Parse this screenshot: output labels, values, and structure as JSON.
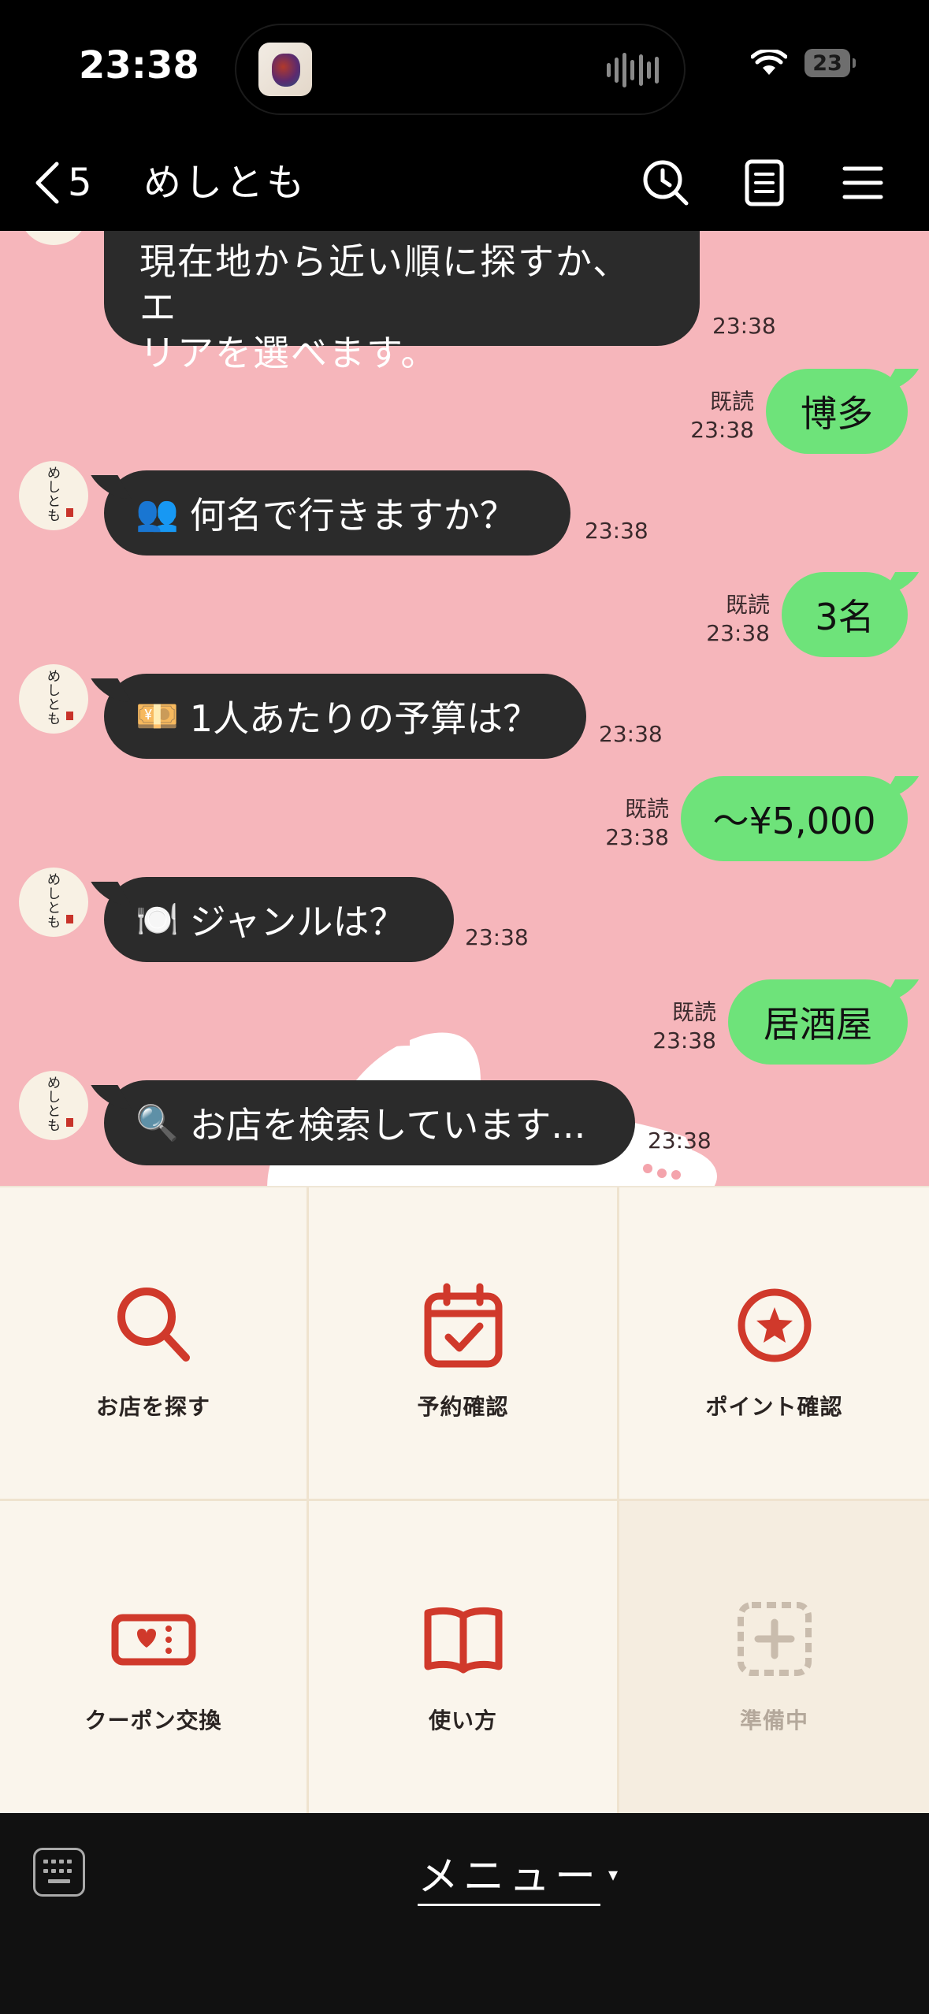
{
  "status_bar": {
    "time": "23:38",
    "battery": "23"
  },
  "nav": {
    "back_count": "5",
    "title": "めしとも"
  },
  "chat": {
    "partial_message": {
      "line1": "現在地から近い順に探すか、エ",
      "line2": "リアを選べます。",
      "time": "23:38"
    },
    "messages": [
      {
        "type": "out",
        "text": "博多",
        "read": "既読",
        "time": "23:38"
      },
      {
        "type": "in",
        "emoji": "👥",
        "text": "何名で行きますか？",
        "time": "23:38"
      },
      {
        "type": "out",
        "text": "3名",
        "read": "既読",
        "time": "23:38"
      },
      {
        "type": "in",
        "emoji": "💴",
        "text": "1人あたりの予算は？",
        "time": "23:38"
      },
      {
        "type": "out",
        "text": "～¥5,000",
        "read": "既読",
        "time": "23:38"
      },
      {
        "type": "in",
        "emoji": "🍽️",
        "text": "ジャンルは？",
        "time": "23:38"
      },
      {
        "type": "out",
        "text": "居酒屋",
        "read": "既読",
        "time": "23:38"
      },
      {
        "type": "in",
        "emoji": "🔍",
        "text": "お店を検索しています...",
        "time": "23:38"
      }
    ],
    "avatar": {
      "chars": [
        "め",
        "し",
        "と",
        "も"
      ]
    }
  },
  "rich_menu": {
    "items": [
      {
        "label": "お店を探す",
        "icon": "search-icon"
      },
      {
        "label": "予約確認",
        "icon": "calendar-check-icon"
      },
      {
        "label": "ポイント確認",
        "icon": "star-circle-icon"
      },
      {
        "label": "クーポン交換",
        "icon": "coupon-icon"
      },
      {
        "label": "使い方",
        "icon": "book-icon"
      },
      {
        "label": "準備中",
        "icon": "plus-box-icon"
      }
    ],
    "accent_color": "#d0392b",
    "disabled_color": "#c9bcad"
  },
  "bottom_bar": {
    "menu_label": "メニュー",
    "caret": "▾"
  }
}
